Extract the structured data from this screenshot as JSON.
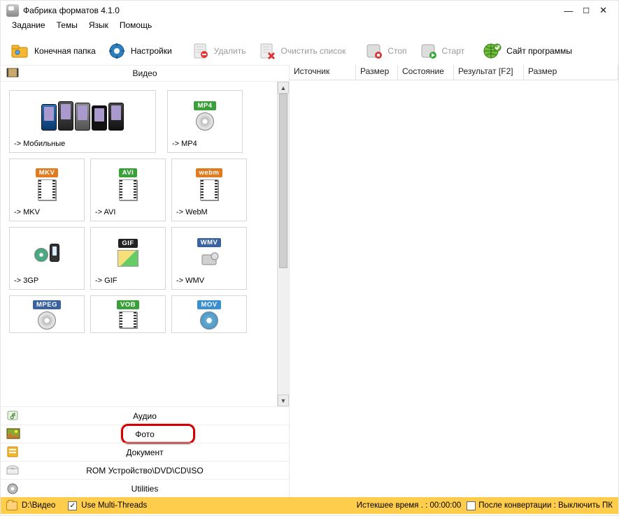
{
  "window": {
    "title": "Фабрика форматов 4.1.0"
  },
  "menu": {
    "task": "Задание",
    "themes": "Темы",
    "lang": "Язык",
    "help": "Помощь"
  },
  "toolbar": {
    "output_folder": "Конечная папка",
    "settings": "Настройки",
    "delete": "Удалить",
    "clear_list": "Очистить список",
    "stop": "Стоп",
    "start": "Старт",
    "site": "Сайт программы"
  },
  "categories": {
    "video": "Видео",
    "audio": "Аудио",
    "photo": "Фото",
    "document": "Документ",
    "rom": "ROM Устройство\\DVD\\CD\\ISO",
    "utilities": "Utilities"
  },
  "formats": {
    "mobile": "-> Мобильные",
    "mp4": "-> MP4",
    "mkv": "-> MKV",
    "avi": "-> AVI",
    "webm": "-> WebM",
    "3gp": "-> 3GP",
    "gif": "-> GIF",
    "wmv": "-> WMV",
    "mpeg_badge": "MPEG",
    "vob_badge": "VOB",
    "mov_badge": "MOV",
    "mp4_badge": "MP4",
    "mkv_badge": "MKV",
    "avi_badge": "AVI",
    "webm_badge": "webm",
    "gif_badge": "GIF",
    "wmv_badge": "WMV"
  },
  "list_headers": {
    "source": "Источник",
    "size": "Размер",
    "status": "Состояние",
    "result": "Результат [F2]",
    "size2": "Размер"
  },
  "status": {
    "path": "D:\\Видео",
    "multithreads": "Use Multi-Threads",
    "elapsed": "Истекшее время . : 00:00:00",
    "after_conv": "После конвертации : Выключить ПК"
  }
}
